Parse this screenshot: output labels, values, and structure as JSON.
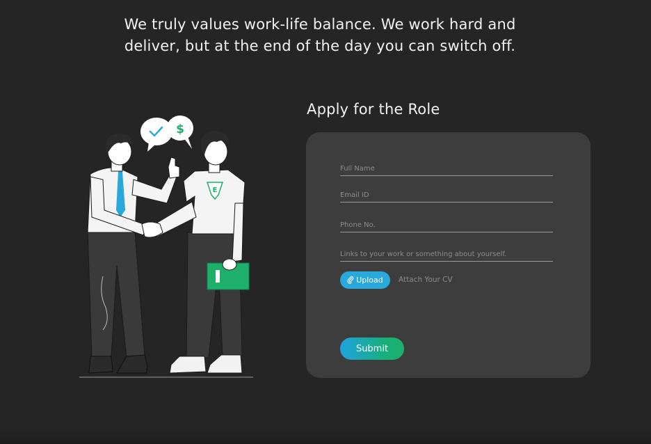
{
  "tagline": {
    "line1": "We truly values work-life balance. We work hard and",
    "line2": "deliver, but at the end of the day you can switch off."
  },
  "form": {
    "title": "Apply for the Role",
    "fields": {
      "full_name": {
        "placeholder": "Full Name",
        "value": ""
      },
      "email": {
        "placeholder": "Email ID",
        "value": ""
      },
      "phone": {
        "placeholder": "Phone No.",
        "value": ""
      },
      "links": {
        "placeholder": "Links to your work or something about yourself.",
        "value": ""
      }
    },
    "upload_label": "Upload",
    "attach_label": "Attach Your CV",
    "submit_label": "Submit"
  },
  "illustration": {
    "shirt_letter": "E",
    "bubble_symbol": "$"
  },
  "colors": {
    "background": "#252525",
    "card": "#3d3d3d",
    "accent_blue": "#29a8dc",
    "accent_green": "#1db06a"
  }
}
